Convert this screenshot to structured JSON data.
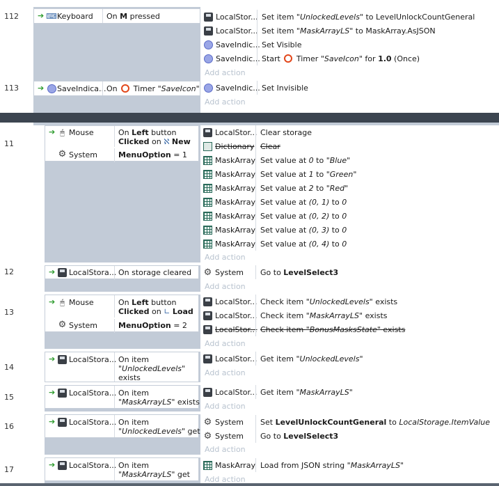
{
  "top_section": {
    "events": [
      {
        "num": "112",
        "conditions": [
          {
            "object": "Keyboard",
            "icon": "keyboard-icon",
            "text_pre": "On ",
            "bold": "M",
            "text_post": " pressed"
          }
        ],
        "actions": [
          {
            "object": "LocalStor...",
            "icon": "local-storage-icon",
            "p1": "Set item ",
            "i1": "\"UnlockedLevels\"",
            "p2": " to LevelUnlockCountGeneral"
          },
          {
            "object": "LocalStor...",
            "icon": "local-storage-icon",
            "p1": "Set item ",
            "i1": "\"MaskArrayLS\"",
            "p2": " to MaskArray.AsJSON"
          },
          {
            "object": "SaveIndic...",
            "icon": "save-indicator-icon",
            "p1": "Set Visible"
          },
          {
            "object": "SaveIndic...",
            "icon": "save-indicator-icon",
            "p1": "Start ",
            "timer": true,
            "p1b": " Timer ",
            "i1": "\"SaveIcon\"",
            "p2": " for ",
            "b2": "1.0",
            "p3": " (Once)"
          }
        ],
        "add_action": "Add action"
      },
      {
        "num": "113",
        "conditions": [
          {
            "object": "SaveIndica...",
            "icon": "save-indicator-icon",
            "text_pre": "On ",
            "timer": true,
            "text_mid": " Timer ",
            "italic": "\"SaveIcon\""
          }
        ],
        "actions": [
          {
            "object": "SaveIndic...",
            "icon": "save-indicator-icon",
            "p1": "Set Invisible"
          }
        ],
        "add_action": "Add action"
      }
    ]
  },
  "bottom_section": {
    "events": [
      {
        "num": "11",
        "conditions": [
          {
            "object": "Mouse",
            "icon": "mouse-icon",
            "line1_pre": "On ",
            "line1_bold": "Left",
            "line1_post": " button",
            "line2_bold": "Clicked",
            "line2_mid": " on ",
            "line2_bold2": "New"
          },
          {
            "object": "System",
            "icon": "gear-icon",
            "bold": "MenuOption",
            "text_post": " = 1"
          }
        ],
        "actions": [
          {
            "object": "LocalStor...",
            "icon": "local-storage-icon",
            "text": "Clear storage"
          },
          {
            "object": "Dictionary",
            "icon": "dictionary-icon",
            "text": "Clear",
            "disabled": true
          },
          {
            "object": "MaskArray",
            "icon": "array-icon",
            "p1": "Set value at ",
            "i1": "0",
            "p2": " to ",
            "i2": "\"Blue\""
          },
          {
            "object": "MaskArray",
            "icon": "array-icon",
            "p1": "Set value at ",
            "i1": "1",
            "p2": " to ",
            "i2": "\"Green\""
          },
          {
            "object": "MaskArray",
            "icon": "array-icon",
            "p1": "Set value at ",
            "i1": "2",
            "p2": " to ",
            "i2": "\"Red\""
          },
          {
            "object": "MaskArray",
            "icon": "array-icon",
            "p1": "Set value at ",
            "i1": "(0, 1)",
            "p2": " to ",
            "i2": "0"
          },
          {
            "object": "MaskArray",
            "icon": "array-icon",
            "p1": "Set value at ",
            "i1": "(0, 2)",
            "p2": " to ",
            "i2": "0"
          },
          {
            "object": "MaskArray",
            "icon": "array-icon",
            "p1": "Set value at ",
            "i1": "(0, 3)",
            "p2": " to ",
            "i2": "0"
          },
          {
            "object": "MaskArray",
            "icon": "array-icon",
            "p1": "Set value at ",
            "i1": "(0, 4)",
            "p2": " to ",
            "i2": "0"
          }
        ],
        "add_action": "Add action"
      },
      {
        "num": "12",
        "conditions": [
          {
            "object": "LocalStora...",
            "icon": "local-storage-icon",
            "text": "On storage cleared"
          }
        ],
        "actions": [
          {
            "object": "System",
            "icon": "gear-icon",
            "p1": "Go to ",
            "b1": "LevelSelect3"
          }
        ],
        "add_action": "Add action"
      },
      {
        "num": "13",
        "conditions": [
          {
            "object": "Mouse",
            "icon": "mouse-icon",
            "line1_pre": "On ",
            "line1_bold": "Left",
            "line1_post": " button",
            "line2_bold": "Clicked",
            "line2_mid": " on ",
            "line2_bold2": "Load"
          },
          {
            "object": "System",
            "icon": "gear-icon",
            "bold": "MenuOption",
            "text_post": " = 2"
          }
        ],
        "actions": [
          {
            "object": "LocalStor...",
            "icon": "local-storage-icon",
            "p1": "Check item ",
            "i1": "\"UnlockedLevels\"",
            "p2": " exists"
          },
          {
            "object": "LocalStor...",
            "icon": "local-storage-icon",
            "p1": "Check item ",
            "i1": "\"MaskArrayLS\"",
            "p2": " exists"
          },
          {
            "object": "LocalStor...",
            "icon": "local-storage-icon",
            "p1": "Check item ",
            "i1": "\"BonusMasksState\"",
            "p2": " exists",
            "disabled": true
          }
        ],
        "add_action": "Add action"
      },
      {
        "num": "14",
        "conditions": [
          {
            "object": "LocalStora...",
            "icon": "local-storage-icon",
            "line1": "On item",
            "line2": "\"UnlockedLevels\"",
            "line3": "exists"
          }
        ],
        "actions": [
          {
            "object": "LocalStor...",
            "icon": "local-storage-icon",
            "p1": "Get item ",
            "i1": "\"UnlockedLevels\""
          }
        ],
        "add_action": "Add action"
      },
      {
        "num": "15",
        "conditions": [
          {
            "object": "LocalStora...",
            "icon": "local-storage-icon",
            "line1": "On item",
            "line2_italic": "\"MaskArrayLS\"",
            "line2_post": " exists"
          }
        ],
        "actions": [
          {
            "object": "LocalStor...",
            "icon": "local-storage-icon",
            "p1": "Get item ",
            "i1": "\"MaskArrayLS\""
          }
        ],
        "add_action": "Add action"
      },
      {
        "num": "16",
        "conditions": [
          {
            "object": "LocalStora...",
            "icon": "local-storage-icon",
            "line1": "On item",
            "line2_italic": "\"UnlockedLevels\"",
            "line2_post": " get"
          }
        ],
        "actions": [
          {
            "object": "System",
            "icon": "gear-icon",
            "p1": "Set ",
            "b1": "LevelUnlockCountGeneral",
            "p2": " to ",
            "i2": "LocalStorage.ItemValue"
          },
          {
            "object": "System",
            "icon": "gear-icon",
            "p1": "Go to ",
            "b1": "LevelSelect3"
          }
        ],
        "add_action": "Add action"
      },
      {
        "num": "17",
        "conditions": [
          {
            "object": "LocalStora...",
            "icon": "local-storage-icon",
            "line1": "On item",
            "line2_italic": "\"MaskArrayLS\"",
            "line2_post": " get"
          }
        ],
        "actions": [
          {
            "object": "MaskArray",
            "icon": "array-icon",
            "p1": "Load from JSON string ",
            "i1": "\"MaskArrayLS\""
          }
        ],
        "add_action": "Add action"
      }
    ]
  },
  "colors": {
    "event_background": "#c2cbd7",
    "divider_bar": "#3c4550",
    "add_action_text": "#b9c3cf",
    "green_arrow": "#2e9c2e",
    "timer_icon": "#e2471b"
  }
}
